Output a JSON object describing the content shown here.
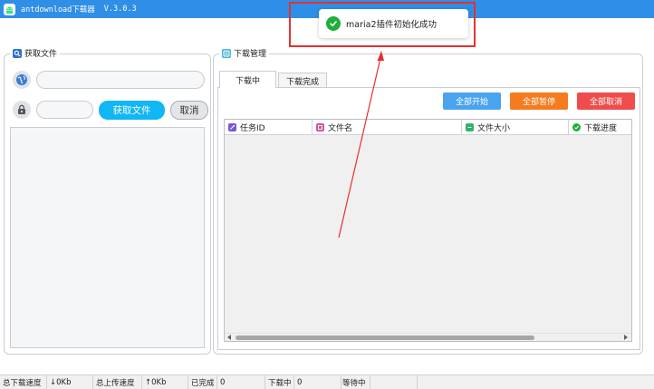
{
  "window": {
    "title": "antdownload下载器",
    "version": "V.3.0.3"
  },
  "get_file_panel": {
    "title": "获取文件",
    "url_placeholder": "",
    "code_placeholder": "",
    "get_button": "获取文件",
    "cancel_button": "取消"
  },
  "download_panel": {
    "title": "下载管理",
    "tabs": [
      {
        "label": "下载中",
        "active": true
      },
      {
        "label": "下载完成",
        "active": false
      }
    ],
    "actions": {
      "start_all": "全部开始",
      "pause_all": "全部暂停",
      "cancel_all": "全部取消"
    },
    "table_headers": {
      "task_id": "任务ID",
      "file_name": "文件名",
      "file_size": "文件大小",
      "progress": "下载进度"
    },
    "rows": []
  },
  "toast": {
    "message": "maria2插件初始化成功"
  },
  "status_bar": {
    "total_download_label": "总下载速度",
    "total_download_value": "↓0Kb",
    "total_upload_label": "总上传速度",
    "total_upload_value": "↑0Kb",
    "completed_label": "已完成",
    "completed_value": "0",
    "downloading_label": "下载中",
    "downloading_value": "0",
    "waiting_label": "等待中",
    "waiting_value": ""
  },
  "colors": {
    "titlebar": "#2f8ee6",
    "primary_button": "#11b6f5",
    "start_all": "#4aa3ef",
    "pause_all": "#f47c1f",
    "cancel_all": "#ef4d4d",
    "success": "#1fae3c",
    "annotation": "#e3312f"
  },
  "icons": {
    "app": "android-icon",
    "get_file": "search-icon",
    "download_manage": "download-manage-icon",
    "url": "globe-icon",
    "code": "lock-icon",
    "toast": "check-circle-icon"
  }
}
